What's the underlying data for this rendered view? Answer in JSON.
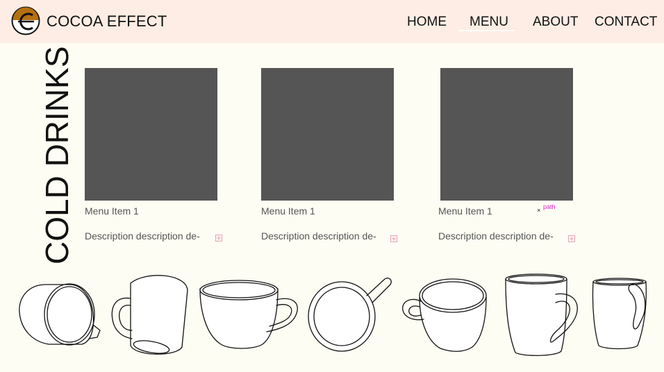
{
  "brand": {
    "name": "COCOA EFFECT"
  },
  "nav": {
    "items": [
      {
        "label": "HOME"
      },
      {
        "label": "MENU"
      },
      {
        "label": "ABOUT"
      },
      {
        "label": "CONTACT"
      }
    ],
    "active": "MENU"
  },
  "section": {
    "title": "COLD DRINKS"
  },
  "menu": {
    "items": [
      {
        "title": "Menu Item 1",
        "description": "Description description de-"
      },
      {
        "title": "Menu Item 1",
        "description": "Description description de-"
      },
      {
        "title": "Menu Item 1",
        "description": "Description description de-"
      }
    ]
  },
  "annotation": {
    "marker": "×",
    "label": "path"
  },
  "colors": {
    "header_bg": "#fdede4",
    "page_bg": "#fdfdf3",
    "image_placeholder": "#555555",
    "logo_fill": "#b5700f",
    "plus_icon": "#e8a0b0",
    "annotation_label": "#e020d0"
  },
  "icons": [
    "logo-cocoa-icon",
    "plus-box-icon",
    "cup-icon"
  ]
}
